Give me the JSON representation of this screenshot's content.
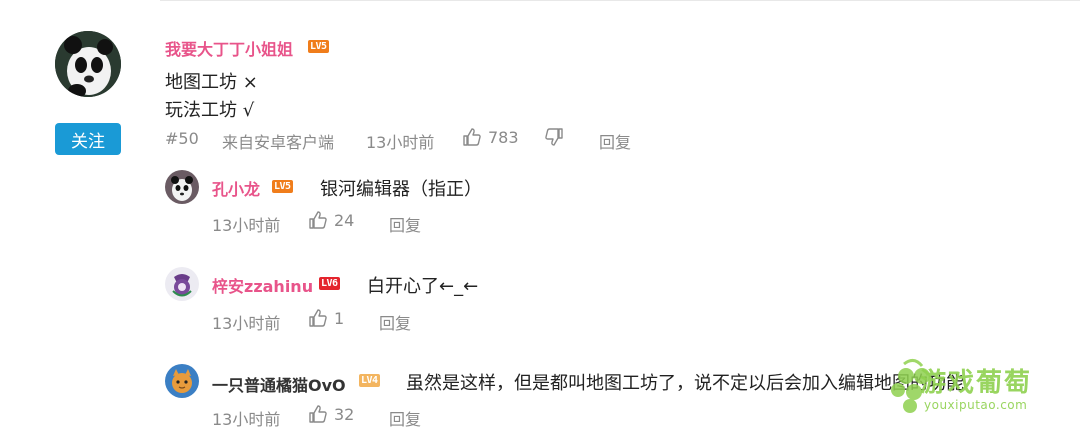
{
  "post": {
    "username": "我要大丁丁小姐姐",
    "level": "LV5",
    "follow_label": "关注",
    "lines": [
      "地图工坊 ×",
      "玩法工坊 √"
    ],
    "floor": "#50",
    "source": "来自安卓客户端",
    "time": "13小时前",
    "likes": "783",
    "reply_label": "回复"
  },
  "replies": [
    {
      "username": "孔小龙",
      "level": "LV5",
      "text": "银河编辑器（指正）",
      "time": "13小时前",
      "likes": "24",
      "reply_label": "回复"
    },
    {
      "username": "梓安zzahinu",
      "level": "LV6",
      "text": "白开心了←_←",
      "time": "13小时前",
      "likes": "1",
      "reply_label": "回复"
    },
    {
      "username": "一只普通橘猫OvO",
      "level": "LV4",
      "text": "虽然是这样，但是都叫地图工坊了，说不定以后会加入编辑地图的功能",
      "time": "13小时前",
      "likes": "32",
      "reply_label": "回复"
    }
  ],
  "watermark": {
    "name": "游戏葡萄",
    "url": "youxiputao.com"
  },
  "colors": {
    "username_pink": "#e8548a",
    "follow_blue": "#1a9ad6",
    "meta_gray": "#8a8a8a",
    "lv_orange": "#f07d1b",
    "lv_red": "#e4242d",
    "lv_gold": "#f3b560",
    "watermark_green": "#8fd14f"
  }
}
